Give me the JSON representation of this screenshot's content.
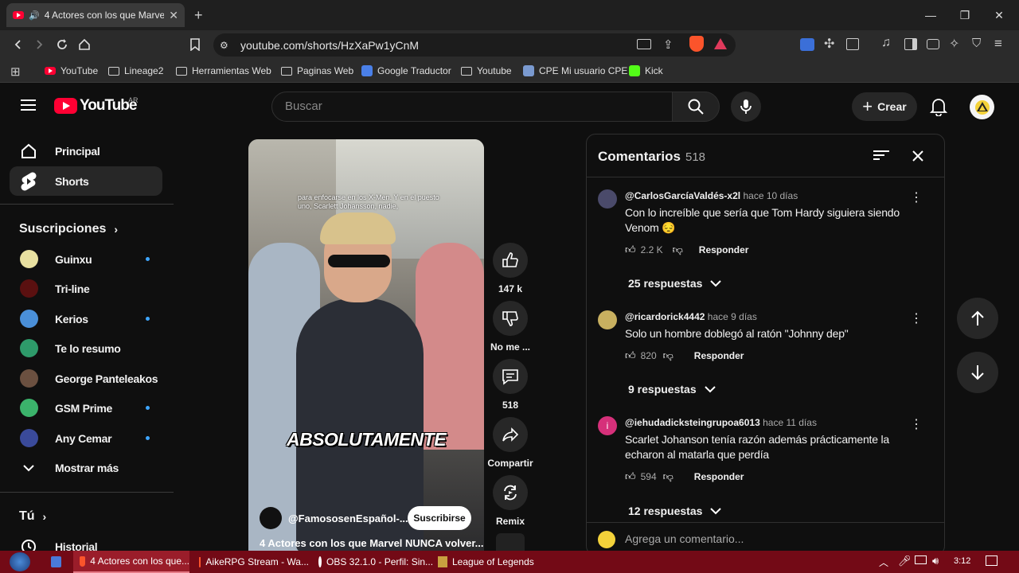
{
  "browser": {
    "tab_title": "4 Actores con los que Marvel",
    "url": "youtube.com/shorts/HzXaPw1yCnM",
    "bookmarks": [
      "YouTube",
      "Lineage2",
      "Herramientas Web",
      "Paginas Web",
      "Google Traductor",
      "Youtube",
      "CPE Mi usuario CPE",
      "Kick"
    ]
  },
  "header": {
    "logo": "YouTube",
    "country": "AR",
    "search_placeholder": "Buscar",
    "create_label": "Crear"
  },
  "sidebar": {
    "main": [
      {
        "label": "Principal",
        "icon": "home-icon"
      },
      {
        "label": "Shorts",
        "icon": "shorts-icon"
      }
    ],
    "subs_title": "Suscripciones",
    "subscriptions": [
      {
        "label": "Guinxu",
        "color": "#e8e0a0",
        "new": true
      },
      {
        "label": "Tri-line",
        "color": "#5a1010",
        "new": false
      },
      {
        "label": "Kerios",
        "color": "#4a8fd8",
        "new": true
      },
      {
        "label": "Te lo resumo",
        "color": "#2e9a6a",
        "new": false
      },
      {
        "label": "George Panteleakos",
        "color": "#6b5040",
        "new": false
      },
      {
        "label": "GSM Prime",
        "color": "#3bb36b",
        "new": true
      },
      {
        "label": "Any Cemar",
        "color": "#3a4a9a",
        "new": true
      }
    ],
    "show_more": "Mostrar más",
    "you_title": "Tú",
    "history": "Historial"
  },
  "video": {
    "caption_small": "para enfocarse en los X-Men. Y en el puesto uno, Scarlett Johansson, nadie,",
    "caption_big": "ABSOLUTAMENTE",
    "channel": "@FamososenEspañol-...",
    "subscribe": "Suscribirse",
    "title": "4 Actores con los que Marvel NUNCA volver..."
  },
  "actions": {
    "likes": "147 k",
    "dislike": "No me ...",
    "comments": "518",
    "share": "Compartir",
    "remix": "Remix"
  },
  "comments": {
    "title": "Comentarios",
    "count": "518",
    "items": [
      {
        "author": "@CarlosGarcíaValdés-x2l",
        "time": "hace 10 días",
        "text": "Con lo increíble que sería que Tom Hardy siguiera siendo Venom 😔",
        "likes": "2.2 K",
        "reply": "Responder",
        "replies": "25 respuestas",
        "avatar_color": "#4a4a6a"
      },
      {
        "author": "@ricardorick4442",
        "time": "hace 9 días",
        "text": "Solo un hombre doblegó al ratón \"Johnny dep\"",
        "likes": "820",
        "reply": "Responder",
        "replies": "9 respuestas",
        "avatar_color": "#c8b060"
      },
      {
        "author": "@iehudadicksteingrupoa6013",
        "time": "hace 11 días",
        "text": "Scarlet Johanson tenía razón además prácticamente la echaron al matarla que perdía",
        "likes": "594",
        "reply": "Responder",
        "replies": "12 respuestas",
        "avatar_color": "#d6307a",
        "avatar_letter": "i"
      }
    ],
    "input_placeholder": "Agrega un comentario..."
  },
  "taskbar": {
    "tasks": [
      "4 Actores con los que...",
      "AikeRPG Stream - Wa...",
      "OBS 32.1.0 - Perfil: Sin...",
      "League of Legends"
    ],
    "clock": "3:12"
  }
}
